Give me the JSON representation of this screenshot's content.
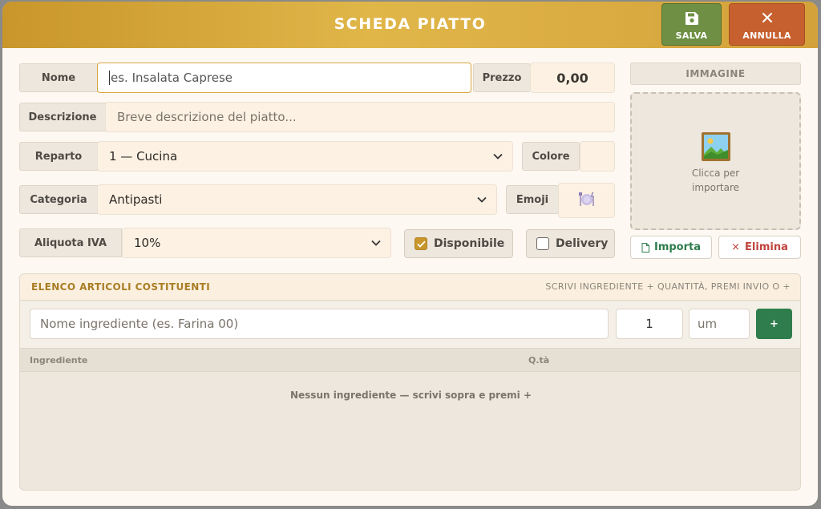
{
  "header": {
    "title": "SCHEDA PIATTO",
    "save_label": "SALVA",
    "cancel_label": "ANNULLA",
    "accent_color": "#d9a640"
  },
  "form": {
    "name": {
      "label": "Nome",
      "placeholder": "es. Insalata Caprese"
    },
    "price": {
      "label": "Prezzo",
      "value": "0,00"
    },
    "description": {
      "label": "Descrizione",
      "placeholder": "Breve descrizione del piatto..."
    },
    "department": {
      "label": "Reparto",
      "value": "1 — Cucina"
    },
    "color": {
      "label": "Colore",
      "value": ""
    },
    "category": {
      "label": "Categoria",
      "value": "Antipasti"
    },
    "emoji": {
      "label": "Emoji",
      "icon": "fork-knife-plate-icon"
    },
    "vat": {
      "label": "Aliquota IVA",
      "value": "10%"
    },
    "available": {
      "label": "Disponibile",
      "checked": true
    },
    "delivery": {
      "label": "Delivery",
      "checked": false
    }
  },
  "image": {
    "label": "IMMAGINE",
    "drop_line1": "Clicca per",
    "drop_line2": "importare",
    "import_label": "Importa",
    "delete_label": "Elimina",
    "delete_symbol": "×"
  },
  "ingredients": {
    "title": "ELENCO ARTICOLI COSTITUENTI",
    "hint": "SCRIVI INGREDIENTE + QUANTITÀ, PREMI INVIO O +",
    "name_placeholder": "Nome ingrediente (es. Farina 00)",
    "qty_value": "1",
    "unit_placeholder": "um",
    "add_label": "+",
    "col_ingredient": "Ingrediente",
    "col_qty": "Q.tà",
    "empty_text": "Nessun ingrediente — scrivi sopra e premi +",
    "rows": []
  }
}
